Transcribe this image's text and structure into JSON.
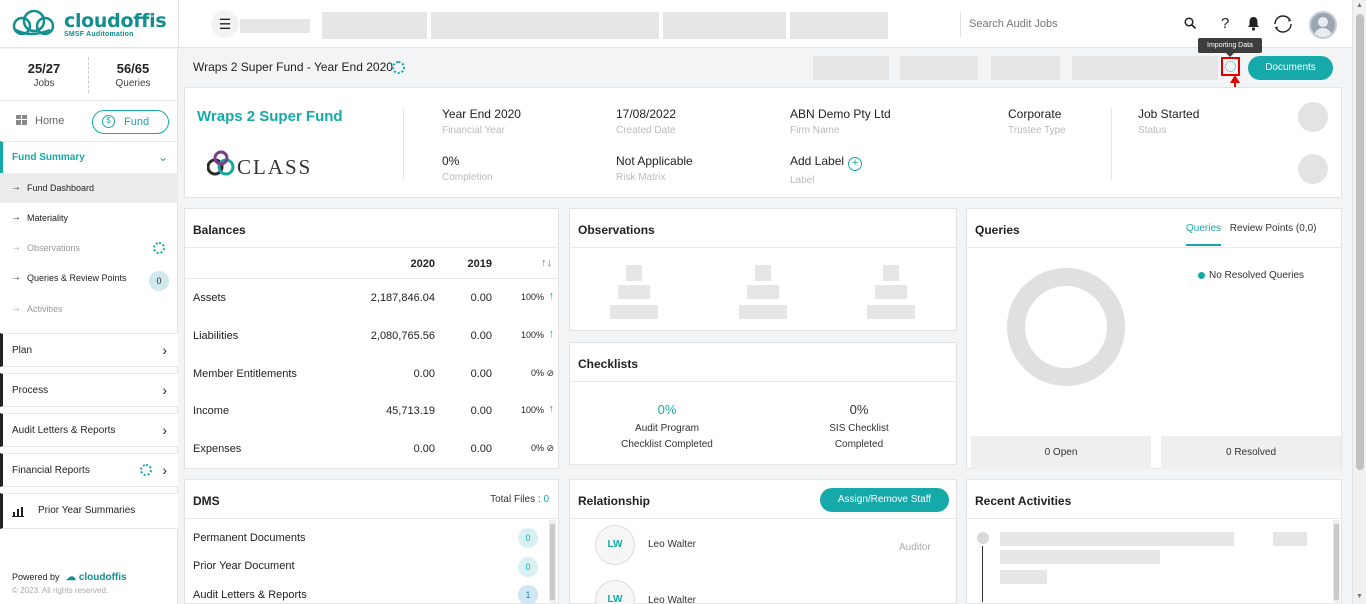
{
  "brand": {
    "name": "cloudoffis",
    "tagline": "SMSF Auditomation"
  },
  "topbar": {
    "search_placeholder": "Search Audit Jobs",
    "help_icon": "?"
  },
  "sidebar": {
    "stats": [
      {
        "value": "25/27",
        "label": "Jobs"
      },
      {
        "value": "56/65",
        "label": "Queries"
      }
    ],
    "home_label": "Home",
    "fund_label": "Fund",
    "fund_summary": {
      "title": "Fund Summary",
      "items": [
        {
          "label": "Fund Dashboard"
        },
        {
          "label": "Materiality"
        },
        {
          "label": "Observations"
        },
        {
          "label": "Queries & Review Points",
          "badge": "0"
        },
        {
          "label": "Activities"
        }
      ]
    },
    "nav": [
      {
        "label": "Plan"
      },
      {
        "label": "Process"
      },
      {
        "label": "Audit Letters & Reports"
      },
      {
        "label": "Financial Reports"
      },
      {
        "label": "Prior Year Summaries"
      }
    ],
    "powered_by": "Powered by",
    "copyright": "© 2023. All rights reserved."
  },
  "header": {
    "title": "Wraps 2 Super Fund - Year End 2020",
    "documents_button": "Documents",
    "tooltip": "Importing Data"
  },
  "fund": {
    "name": "Wraps 2 Super Fund",
    "logo_text": "CLASS",
    "fields": [
      {
        "value": "Year End 2020",
        "label": "Financial Year"
      },
      {
        "value": "17/08/2022",
        "label": "Created Date"
      },
      {
        "value": "ABN Demo Pty Ltd",
        "label": "Firm Name"
      },
      {
        "value": "Corporate",
        "label": "Trustee Type"
      },
      {
        "value": "Job Started",
        "label": "Status"
      },
      {
        "value": "0%",
        "label": "Completion"
      },
      {
        "value": "Not Applicable",
        "label": "Risk Matrix"
      },
      {
        "value": "Add Label",
        "label": "Label"
      }
    ]
  },
  "balances": {
    "title": "Balances",
    "columns": [
      "2020",
      "2019"
    ],
    "rows": [
      {
        "label": "Assets",
        "y2020": "2,187,846.04",
        "y2019": "0.00",
        "change": "100%",
        "dir": "↑"
      },
      {
        "label": "Liabilities",
        "y2020": "2,080,765.56",
        "y2019": "0.00",
        "change": "100%",
        "dir": "↑"
      },
      {
        "label": "Member Entitlements",
        "y2020": "0.00",
        "y2019": "0.00",
        "change": "0%",
        "dir": "⊘"
      },
      {
        "label": "Income",
        "y2020": "45,713.19",
        "y2019": "0.00",
        "change": "100%",
        "dir": "↑"
      },
      {
        "label": "Expenses",
        "y2020": "0.00",
        "y2019": "0.00",
        "change": "0%",
        "dir": "⊘"
      }
    ]
  },
  "observations": {
    "title": "Observations"
  },
  "checklists": {
    "title": "Checklists",
    "items": [
      {
        "pct": "0%",
        "line1": "Audit Program",
        "line2": "Checklist Completed"
      },
      {
        "pct": "0%",
        "line1": "SIS Checklist",
        "line2": "Completed"
      }
    ]
  },
  "queries": {
    "title": "Queries",
    "tabs": [
      "Queries",
      "Review Points (0,0)"
    ],
    "legend": "No Resolved Queries",
    "open": "0 Open",
    "resolved": "0 Resolved"
  },
  "dms": {
    "title": "DMS",
    "total_label": "Total Files : ",
    "total_value": "0",
    "items": [
      {
        "label": "Permanent Documents",
        "count": "0"
      },
      {
        "label": "Prior Year Document",
        "count": "0"
      },
      {
        "label": "Audit Letters & Reports",
        "count": "1"
      }
    ]
  },
  "relationship": {
    "title": "Relationship",
    "assign_button": "Assign/Remove Staff",
    "people": [
      {
        "initials": "LW",
        "name": "Leo Walter",
        "role": "Auditor"
      },
      {
        "initials": "LW",
        "name": "Leo Walter",
        "role": ""
      }
    ]
  },
  "recent": {
    "title": "Recent Activities"
  },
  "colors": {
    "accent": "#16a9a9",
    "highlight": "#e00000"
  }
}
